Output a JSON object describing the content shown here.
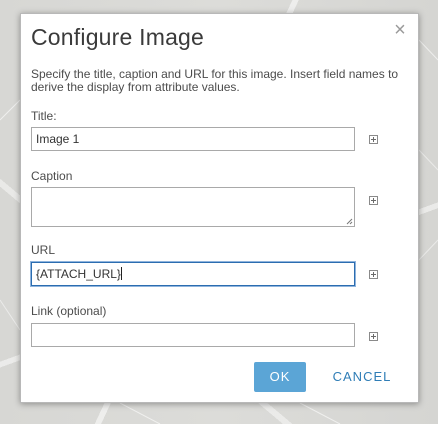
{
  "dialog": {
    "title": "Configure Image",
    "close_icon": "close-icon",
    "description": "Specify the title, caption and URL for this image. Insert field names to derive the display from attribute values."
  },
  "fields": {
    "title": {
      "label": "Title:",
      "value": "Image 1"
    },
    "caption": {
      "label": "Caption",
      "value": ""
    },
    "url": {
      "label": "URL",
      "value": "{ATTACH_URL}"
    },
    "link": {
      "label": "Link (optional)",
      "value": ""
    }
  },
  "buttons": {
    "ok": "OK",
    "cancel": "CANCEL"
  },
  "colors": {
    "ok_button": "#5ba5d6",
    "cancel_text": "#2f7db6",
    "focus_border": "#2c6db0"
  }
}
